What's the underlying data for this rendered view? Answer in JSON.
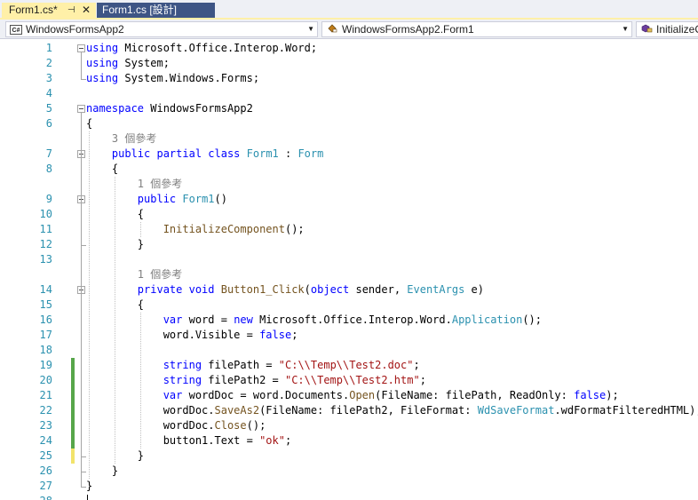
{
  "tabs": {
    "active": {
      "title": "Form1.cs*",
      "pin_glyph": "⊣",
      "close_glyph": "✕"
    },
    "inactive": {
      "title": "Form1.cs [設計]"
    }
  },
  "navbar": {
    "project": "WindowsFormsApp2",
    "class": "WindowsFormsApp2.Form1",
    "member": "InitializeComponent()"
  },
  "colors": {
    "keyword": "#0000ff",
    "type": "#2b91af",
    "string": "#a31515",
    "method": "#74531f",
    "lens": "#808080",
    "line_number": "#2b91af",
    "change_saved": "#57a64a",
    "change_unsaved": "#f2e36b"
  },
  "editor": {
    "lines": [
      {
        "n": "1",
        "fold": true,
        "t": [
          [
            "kw",
            "using"
          ],
          [
            "p",
            " Microsoft.Office.Interop.Word;"
          ]
        ]
      },
      {
        "n": "2",
        "t": [
          [
            "kw",
            "using"
          ],
          [
            "p",
            " System;"
          ]
        ]
      },
      {
        "n": "3",
        "t": [
          [
            "kw",
            "using"
          ],
          [
            "p",
            " System.Windows.Forms;"
          ]
        ]
      },
      {
        "n": "4",
        "t": []
      },
      {
        "n": "5",
        "fold": true,
        "t": [
          [
            "kw",
            "namespace"
          ],
          [
            "p",
            " WindowsFormsApp2"
          ]
        ]
      },
      {
        "n": "6",
        "t": [
          [
            "p",
            "{"
          ]
        ]
      },
      {
        "lens": true,
        "t": [
          [
            "lens",
            "    3 個參考"
          ]
        ]
      },
      {
        "n": "7",
        "fold": true,
        "t": [
          [
            "p",
            "    "
          ],
          [
            "kw",
            "public partial class"
          ],
          [
            "p",
            " "
          ],
          [
            "ty",
            "Form1"
          ],
          [
            "p",
            " : "
          ],
          [
            "ty",
            "Form"
          ]
        ]
      },
      {
        "n": "8",
        "t": [
          [
            "p",
            "    {"
          ]
        ]
      },
      {
        "lens": true,
        "t": [
          [
            "lens",
            "        1 個參考"
          ]
        ]
      },
      {
        "n": "9",
        "fold": true,
        "t": [
          [
            "p",
            "        "
          ],
          [
            "kw",
            "public"
          ],
          [
            "p",
            " "
          ],
          [
            "ty",
            "Form1"
          ],
          [
            "p",
            "()"
          ]
        ]
      },
      {
        "n": "10",
        "t": [
          [
            "p",
            "        {"
          ]
        ]
      },
      {
        "n": "11",
        "t": [
          [
            "p",
            "            "
          ],
          [
            "me",
            "InitializeComponent"
          ],
          [
            "p",
            "();"
          ]
        ]
      },
      {
        "n": "12",
        "t": [
          [
            "p",
            "        }"
          ]
        ]
      },
      {
        "n": "13",
        "t": []
      },
      {
        "lens": true,
        "t": [
          [
            "lens",
            "        1 個參考"
          ]
        ]
      },
      {
        "n": "14",
        "fold": true,
        "t": [
          [
            "p",
            "        "
          ],
          [
            "kw",
            "private void"
          ],
          [
            "p",
            " "
          ],
          [
            "me",
            "Button1_Click"
          ],
          [
            "p",
            "("
          ],
          [
            "kw",
            "object"
          ],
          [
            "p",
            " sender, "
          ],
          [
            "ty",
            "EventArgs"
          ],
          [
            "p",
            " e)"
          ]
        ]
      },
      {
        "n": "15",
        "t": [
          [
            "p",
            "        {"
          ]
        ]
      },
      {
        "n": "16",
        "t": [
          [
            "p",
            "            "
          ],
          [
            "kw",
            "var"
          ],
          [
            "p",
            " word = "
          ],
          [
            "kw",
            "new"
          ],
          [
            "p",
            " Microsoft.Office.Interop.Word."
          ],
          [
            "ty",
            "Application"
          ],
          [
            "p",
            "();"
          ]
        ]
      },
      {
        "n": "17",
        "t": [
          [
            "p",
            "            word.Visible = "
          ],
          [
            "kw",
            "false"
          ],
          [
            "p",
            ";"
          ]
        ]
      },
      {
        "n": "18",
        "t": []
      },
      {
        "n": "19",
        "chg": "green",
        "t": [
          [
            "p",
            "            "
          ],
          [
            "kw",
            "string"
          ],
          [
            "p",
            " filePath = "
          ],
          [
            "st",
            "\"C:\\\\Temp\\\\Test2.doc\""
          ],
          [
            "p",
            ";"
          ]
        ]
      },
      {
        "n": "20",
        "chg": "green",
        "t": [
          [
            "p",
            "            "
          ],
          [
            "kw",
            "string"
          ],
          [
            "p",
            " filePath2 = "
          ],
          [
            "st",
            "\"C:\\\\Temp\\\\Test2.htm\""
          ],
          [
            "p",
            ";"
          ]
        ]
      },
      {
        "n": "21",
        "chg": "green",
        "t": [
          [
            "p",
            "            "
          ],
          [
            "kw",
            "var"
          ],
          [
            "p",
            " wordDoc = word.Documents."
          ],
          [
            "me",
            "Open"
          ],
          [
            "p",
            "(FileName: filePath, ReadOnly: "
          ],
          [
            "kw",
            "false"
          ],
          [
            "p",
            ");"
          ]
        ]
      },
      {
        "n": "22",
        "chg": "green",
        "t": [
          [
            "p",
            "            wordDoc."
          ],
          [
            "me",
            "SaveAs2"
          ],
          [
            "p",
            "(FileName: filePath2, FileFormat: "
          ],
          [
            "ty",
            "WdSaveFormat"
          ],
          [
            "p",
            ".wdFormatFilteredHTML);"
          ]
        ]
      },
      {
        "n": "23",
        "chg": "green",
        "t": [
          [
            "p",
            "            wordDoc."
          ],
          [
            "me",
            "Close"
          ],
          [
            "p",
            "();"
          ]
        ]
      },
      {
        "n": "24",
        "chg": "green",
        "t": [
          [
            "p",
            "            button1.Text = "
          ],
          [
            "st",
            "\"ok\""
          ],
          [
            "p",
            ";"
          ]
        ]
      },
      {
        "n": "25",
        "chg": "yellow",
        "t": [
          [
            "p",
            "        }"
          ]
        ]
      },
      {
        "n": "26",
        "t": [
          [
            "p",
            "    }"
          ]
        ]
      },
      {
        "n": "27",
        "t": [
          [
            "p",
            "}"
          ]
        ]
      },
      {
        "n": "28",
        "t": []
      }
    ]
  }
}
